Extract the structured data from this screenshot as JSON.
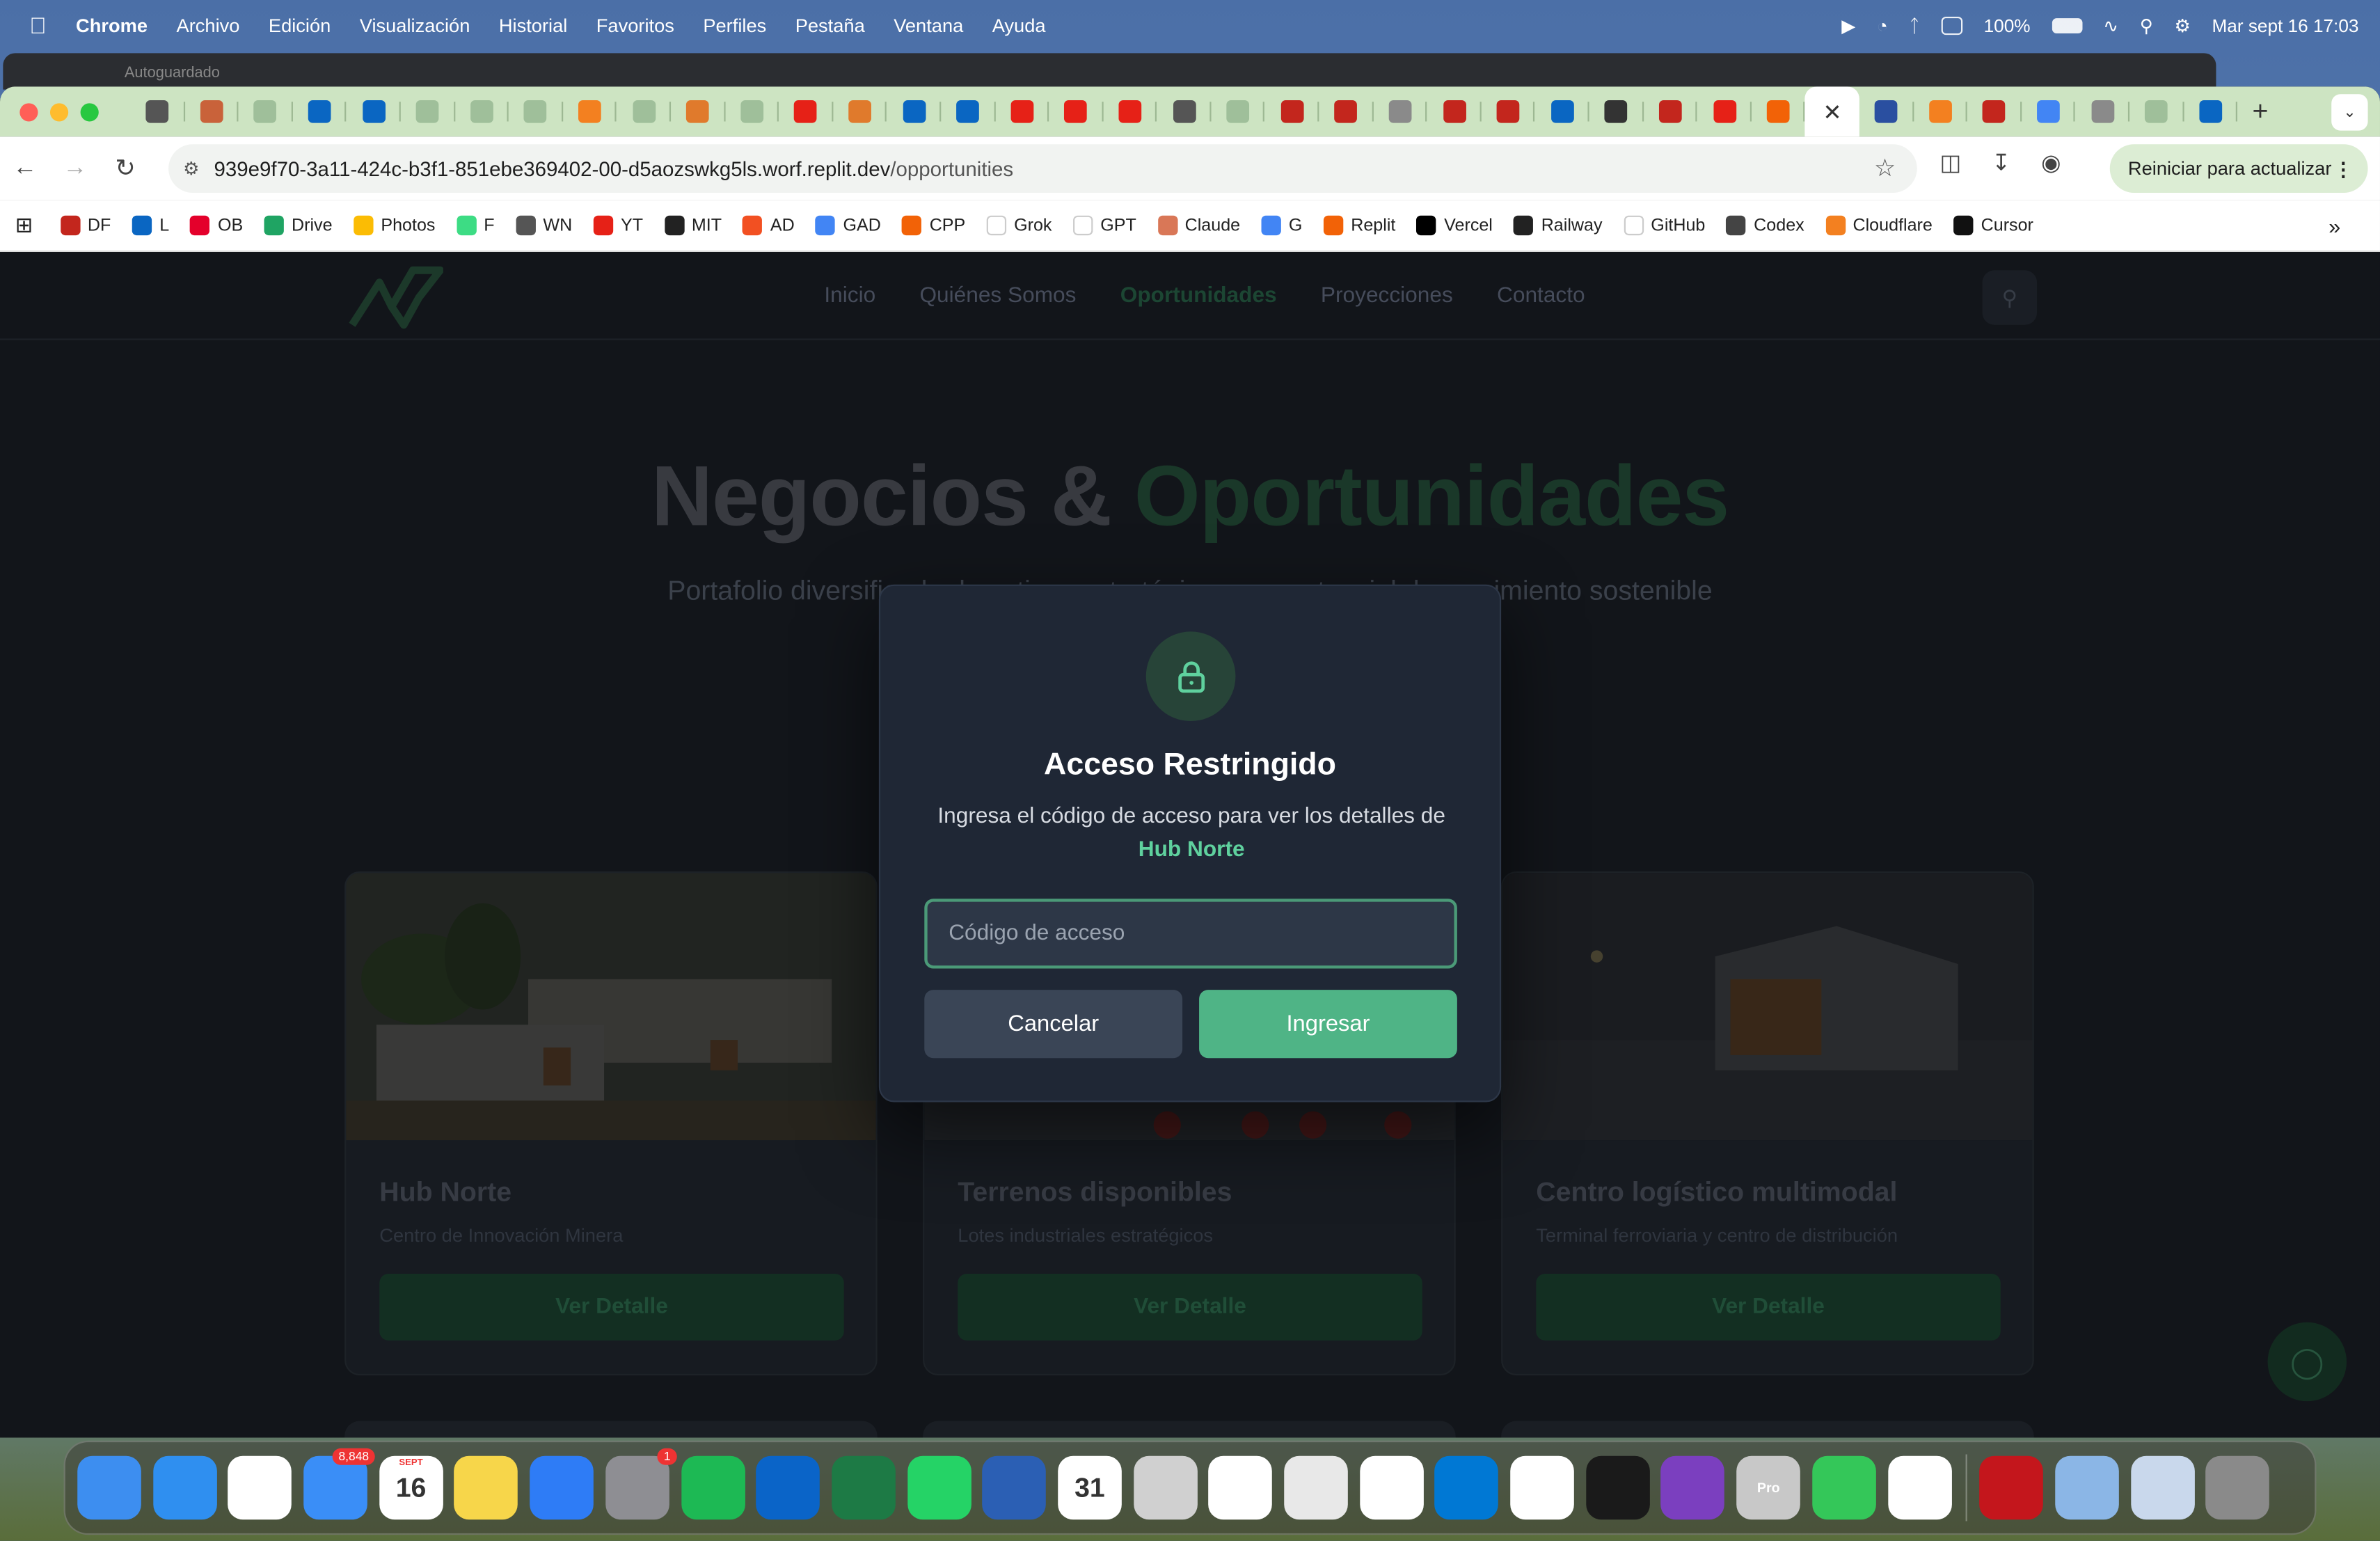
{
  "menubar": {
    "app": "Chrome",
    "items": [
      "Archivo",
      "Edición",
      "Visualización",
      "Historial",
      "Favoritos",
      "Perfiles",
      "Pestaña",
      "Ventana",
      "Ayuda"
    ],
    "battery": "100%",
    "datetime": "Mar sept 16  17:03"
  },
  "bg_window": {
    "title": "Autoguardado"
  },
  "browser": {
    "url": "939e9f70-3a11-424c-b3f1-851ebe369402-00-d5aozswkg5ls.worf.replit.dev/opportunities",
    "url_host": "939e9f70-3a11-424c-b3f1-851ebe369402-00-d5aozswkg5ls.worf.replit.dev",
    "url_path": "/opportunities",
    "update_label": "Reiniciar para actualizar",
    "close_tab_glyph": "✕",
    "new_tab_glyph": "+",
    "tab_colors": [
      "#555",
      "#c9623a",
      "#9fbf9a",
      "#0a66c2",
      "#0a66c2",
      "#9fbf9a",
      "#9fbf9a",
      "#9fbf9a",
      "#f38020",
      "#9fbf9a",
      "#e07a2c",
      "#9fbf9a",
      "#e62117",
      "#e07a2c",
      "#0a66c2",
      "#0a66c2",
      "#e62117",
      "#e62117",
      "#e62117",
      "#555",
      "#9fbf9a",
      "#c3261d",
      "#c3261d",
      "#8a8a8a",
      "#c3261d",
      "#c3261d",
      "#0a66c2",
      "#333",
      "#c3261d",
      "#e62117",
      "#f26207"
    ],
    "tab_after_active_colors": [
      "#2a4fa0",
      "#f38020",
      "#c3261d",
      "#4285f4",
      "#8a8a8a",
      "#9fbf9a",
      "#0a66c2"
    ]
  },
  "bookmarks": [
    {
      "label": "DF",
      "color": "#c3261d"
    },
    {
      "label": "L",
      "color": "#0a66c2"
    },
    {
      "label": "OB",
      "color": "#e4002b"
    },
    {
      "label": "Drive",
      "color": "#1fa463"
    },
    {
      "label": "Photos",
      "color": "#fbbc04"
    },
    {
      "label": "F",
      "color": "#3ddc84"
    },
    {
      "label": "WN",
      "color": "#555"
    },
    {
      "label": "YT",
      "color": "#e62117"
    },
    {
      "label": "MIT",
      "color": "#222"
    },
    {
      "label": "AD",
      "color": "#f25022"
    },
    {
      "label": "GAD",
      "color": "#4285f4"
    },
    {
      "label": "CPP",
      "color": "#f26207"
    },
    {
      "label": "Grok",
      "color": "#ffffff"
    },
    {
      "label": "GPT",
      "color": "#ffffff"
    },
    {
      "label": "Claude",
      "color": "#d97757"
    },
    {
      "label": "G",
      "color": "#4285f4"
    },
    {
      "label": "Replit",
      "color": "#f26207"
    },
    {
      "label": "Vercel",
      "color": "#000"
    },
    {
      "label": "Railway",
      "color": "#222"
    },
    {
      "label": "GitHub",
      "color": "#ffffff"
    },
    {
      "label": "Codex",
      "color": "#444"
    },
    {
      "label": "Cloudflare",
      "color": "#f38020"
    },
    {
      "label": "Cursor",
      "color": "#111"
    }
  ],
  "site": {
    "nav": [
      "Inicio",
      "Quiénes Somos",
      "Oportunidades",
      "Proyecciones",
      "Contacto"
    ],
    "active_nav": "Oportunidades",
    "hero_title_a": "Negocios & ",
    "hero_title_b": "Oportunidades",
    "hero_subtitle": "Portafolio diversificado de activos estratégicos con potencial de crecimiento sostenible",
    "cards": [
      {
        "title": "Hub Norte",
        "subtitle": "Centro de Innovación Minera",
        "button": "Ver Detalle"
      },
      {
        "title": "Terrenos disponibles",
        "subtitle": "Lotes industriales estratégicos",
        "button": "Ver Detalle"
      },
      {
        "title": "Centro logístico multimodal",
        "subtitle": "Terminal ferroviaria y centro de distribución",
        "button": "Ver Detalle"
      }
    ]
  },
  "modal": {
    "title": "Acceso Restringido",
    "description": "Ingresa el código de acceso para ver los detalles de",
    "project": "Hub Norte",
    "input_placeholder": "Código de acceso",
    "input_value": "",
    "cancel_label": "Cancelar",
    "submit_label": "Ingresar"
  },
  "dock": {
    "apps": [
      {
        "name": "Finder",
        "color": "#3d8ef0"
      },
      {
        "name": "Safari",
        "color": "#2f8ff0"
      },
      {
        "name": "Chrome",
        "color": "#ffffff"
      },
      {
        "name": "Mail",
        "color": "#3a8ef7",
        "badge": "8,848"
      },
      {
        "name": "Calendar",
        "color": "#ffffff",
        "text": "16",
        "month": "SEPT"
      },
      {
        "name": "Notes",
        "color": "#f7d64a"
      },
      {
        "name": "Keynote",
        "color": "#2e7cf6"
      },
      {
        "name": "System Settings",
        "color": "#8e8e93",
        "badge": "1"
      },
      {
        "name": "Spotify",
        "color": "#1db954"
      },
      {
        "name": "Outlook",
        "color": "#0a64c8"
      },
      {
        "name": "Excel",
        "color": "#1d7a45"
      },
      {
        "name": "WhatsApp",
        "color": "#25d366"
      },
      {
        "name": "Word",
        "color": "#2b5fb4"
      },
      {
        "name": "Fantastical",
        "color": "#ffffff",
        "text": "31"
      },
      {
        "name": "iPhone Mirroring",
        "color": "#d0d0d0"
      },
      {
        "name": "Ollama",
        "color": "#ffffff"
      },
      {
        "name": "Parallels",
        "color": "#e8e8e8"
      },
      {
        "name": "Cube",
        "color": "#ffffff"
      },
      {
        "name": "VS Code",
        "color": "#0078d4"
      },
      {
        "name": "ChatGPT",
        "color": "#ffffff"
      },
      {
        "name": "Terminal",
        "color": "#1a1a1a"
      },
      {
        "name": "GitHub Desktop",
        "color": "#7b3fbf"
      },
      {
        "name": "Pro",
        "color": "#c8c8c8",
        "text": "Pro"
      },
      {
        "name": "Messages",
        "color": "#34c759"
      },
      {
        "name": "Home",
        "color": "#ffffff"
      }
    ],
    "apps_right": [
      {
        "name": "Acrobat",
        "color": "#c4161c"
      },
      {
        "name": "Preview",
        "color": "#8bb6e6"
      },
      {
        "name": "Downloads",
        "color": "#c9d8ec"
      },
      {
        "name": "Trash",
        "color": "#8a8a8a"
      }
    ]
  }
}
